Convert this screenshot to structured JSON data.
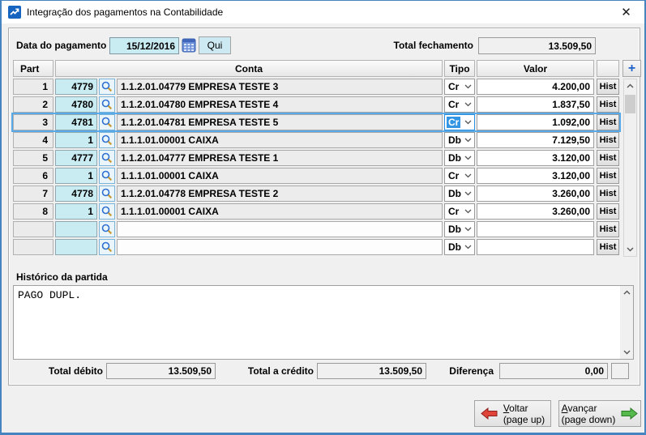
{
  "window": {
    "title": "Integração dos pagamentos na Contabilidade",
    "close_glyph": "✕"
  },
  "header": {
    "date_label": "Data do pagamento",
    "date_value": "15/12/2016",
    "weekday_button": "Qui",
    "total_label": "Total fechamento",
    "total_value": "13.509,50"
  },
  "table": {
    "columns": {
      "part": "Part",
      "conta": "Conta",
      "tipo": "Tipo",
      "valor": "Valor"
    },
    "add_label": "+",
    "hist_label": "Hist",
    "rows": [
      {
        "part": "1",
        "code": "4779",
        "conta": "1.1.2.01.04779 EMPRESA TESTE 3",
        "tipo": "Cr",
        "valor": "4.200,00",
        "selected": false
      },
      {
        "part": "2",
        "code": "4780",
        "conta": "1.1.2.01.04780 EMPRESA TESTE 4",
        "tipo": "Cr",
        "valor": "1.837,50",
        "selected": false
      },
      {
        "part": "3",
        "code": "4781",
        "conta": "1.1.2.01.04781 EMPRESA TESTE 5",
        "tipo": "Cr",
        "valor": "1.092,00",
        "selected": true
      },
      {
        "part": "4",
        "code": "1",
        "conta": "1.1.1.01.00001 CAIXA",
        "tipo": "Db",
        "valor": "7.129,50",
        "selected": false
      },
      {
        "part": "5",
        "code": "4777",
        "conta": "1.1.2.01.04777 EMPRESA TESTE 1",
        "tipo": "Db",
        "valor": "3.120,00",
        "selected": false
      },
      {
        "part": "6",
        "code": "1",
        "conta": "1.1.1.01.00001 CAIXA",
        "tipo": "Cr",
        "valor": "3.120,00",
        "selected": false
      },
      {
        "part": "7",
        "code": "4778",
        "conta": "1.1.2.01.04778 EMPRESA TESTE 2",
        "tipo": "Db",
        "valor": "3.260,00",
        "selected": false
      },
      {
        "part": "8",
        "code": "1",
        "conta": "1.1.1.01.00001 CAIXA",
        "tipo": "Cr",
        "valor": "3.260,00",
        "selected": false
      },
      {
        "part": "",
        "code": "",
        "conta": "",
        "tipo": "Db",
        "valor": "",
        "selected": false
      },
      {
        "part": "",
        "code": "",
        "conta": "",
        "tipo": "Db",
        "valor": "",
        "selected": false
      }
    ]
  },
  "historico": {
    "label": "Histórico da partida",
    "text": "PAGO DUPL."
  },
  "totals": {
    "debit_label": "Total débito",
    "debit_value": "13.509,50",
    "credit_label": "Total a crédito",
    "credit_value": "13.509,50",
    "diff_label": "Diferença",
    "diff_value": "0,00"
  },
  "footer": {
    "back_label": "Voltar",
    "back_sub": "(page up)",
    "forward_label": "Avançar",
    "forward_sub": "(page down)"
  },
  "colors": {
    "accent_border_blue": "#4584be",
    "selection_blue": "#3296e4",
    "field_cyan": "#c9ecf3",
    "back_arrow_red": "#e04338",
    "forward_arrow_green": "#56b94c",
    "plus_icon_blue": "#1e62c9"
  }
}
